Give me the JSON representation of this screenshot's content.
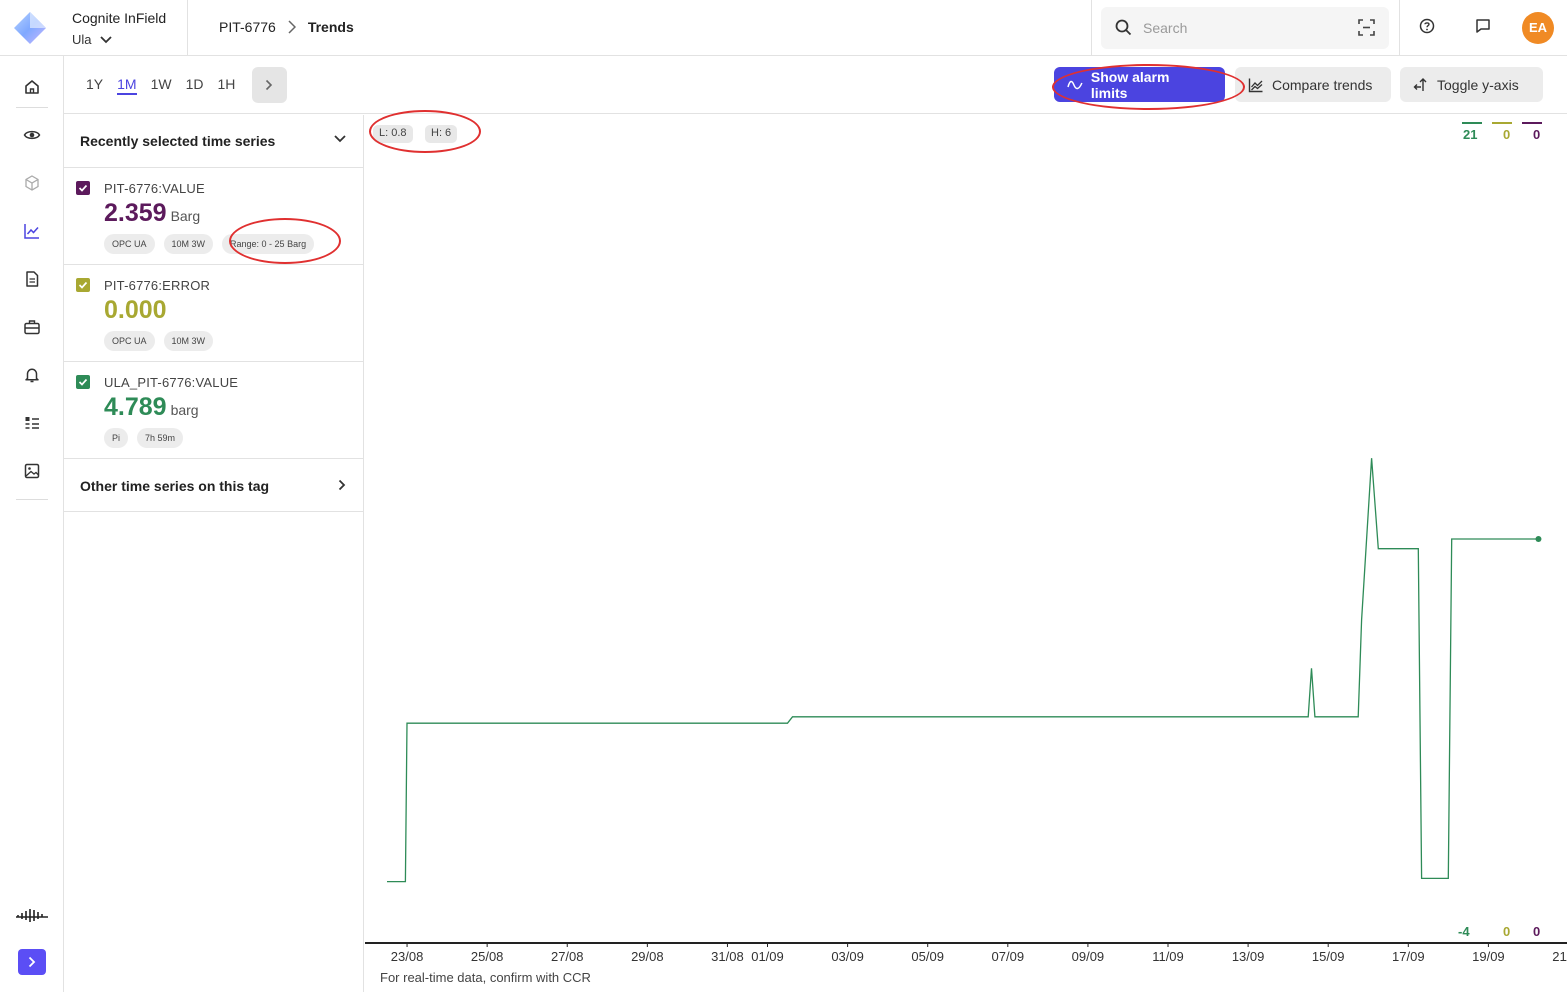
{
  "header": {
    "app_name": "Cognite InField",
    "site": "Ula",
    "breadcrumb": [
      "PIT-6776",
      "Trends"
    ],
    "search_placeholder": "Search",
    "avatar_initials": "EA",
    "avatar_color": "#f08a24"
  },
  "sidebar": {
    "icons": [
      "home-icon",
      "eye-icon",
      "cube-icon",
      "trend-icon",
      "document-icon",
      "toolbox-icon",
      "bell-icon",
      "checklist-icon",
      "image-icon"
    ],
    "active": "trend-icon"
  },
  "toolbar": {
    "ranges": [
      "1Y",
      "1M",
      "1W",
      "1D",
      "1H"
    ],
    "active_range": "1M",
    "show_alarm_limits": "Show alarm limits",
    "compare_trends": "Compare trends",
    "toggle_y_axis": "Toggle y-axis",
    "accent": "#4b44e0"
  },
  "panel": {
    "recent_title": "Recently selected time series",
    "series": [
      {
        "name": "PIT-6776:VALUE",
        "value": "2.359",
        "unit": "Barg",
        "color": "#5c1a5c",
        "chips": [
          "OPC UA",
          "10M 3W",
          "Range: 0 - 25 Barg"
        ]
      },
      {
        "name": "PIT-6776:ERROR",
        "value": "0.000",
        "unit": "",
        "color": "#a8a832",
        "chips": [
          "OPC UA",
          "10M 3W"
        ]
      },
      {
        "name": "ULA_PIT-6776:VALUE",
        "value": "4.789",
        "unit": "barg",
        "color": "#2e8b57",
        "chips": [
          "Pi",
          "7h 59m"
        ]
      }
    ],
    "other_title": "Other time series on this tag"
  },
  "chart": {
    "limits": {
      "low": "L: 0.8",
      "high": "H: 6"
    },
    "scale_top": [
      "21",
      "0",
      "0"
    ],
    "scale_bottom": [
      "-4",
      "0",
      "0"
    ],
    "footnote": "For real-time data, confirm with CCR"
  },
  "chart_data": {
    "type": "line",
    "x_ticks": [
      "23/08",
      "25/08",
      "27/08",
      "29/08",
      "31/08",
      "01/09",
      "03/09",
      "05/09",
      "07/09",
      "09/09",
      "11/09",
      "13/09",
      "15/09",
      "17/09",
      "19/09",
      "21/09"
    ],
    "ylim": [
      -4,
      21
    ],
    "series": [
      {
        "name": "ULA_PIT-6776:VALUE",
        "color": "#2e8b57",
        "points": [
          [
            "22/08 12:00",
            -2.1
          ],
          [
            "22/08 23:00",
            -2.1
          ],
          [
            "23/08 00:00",
            2.8
          ],
          [
            "01/09 12:00",
            2.8
          ],
          [
            "01/09 15:00",
            3.0
          ],
          [
            "14/09 12:00",
            3.0
          ],
          [
            "14/09 14:00",
            4.5
          ],
          [
            "14/09 16:00",
            3.0
          ],
          [
            "15/09 18:00",
            3.0
          ],
          [
            "15/09 20:00",
            6.0
          ],
          [
            "16/09 02:00",
            11.0
          ],
          [
            "16/09 06:00",
            8.2
          ],
          [
            "17/09 06:00",
            8.2
          ],
          [
            "17/09 08:00",
            -2.0
          ],
          [
            "18/09 00:00",
            -2.0
          ],
          [
            "18/09 02:00",
            8.5
          ],
          [
            "20/09 06:00",
            8.5
          ]
        ]
      }
    ]
  }
}
